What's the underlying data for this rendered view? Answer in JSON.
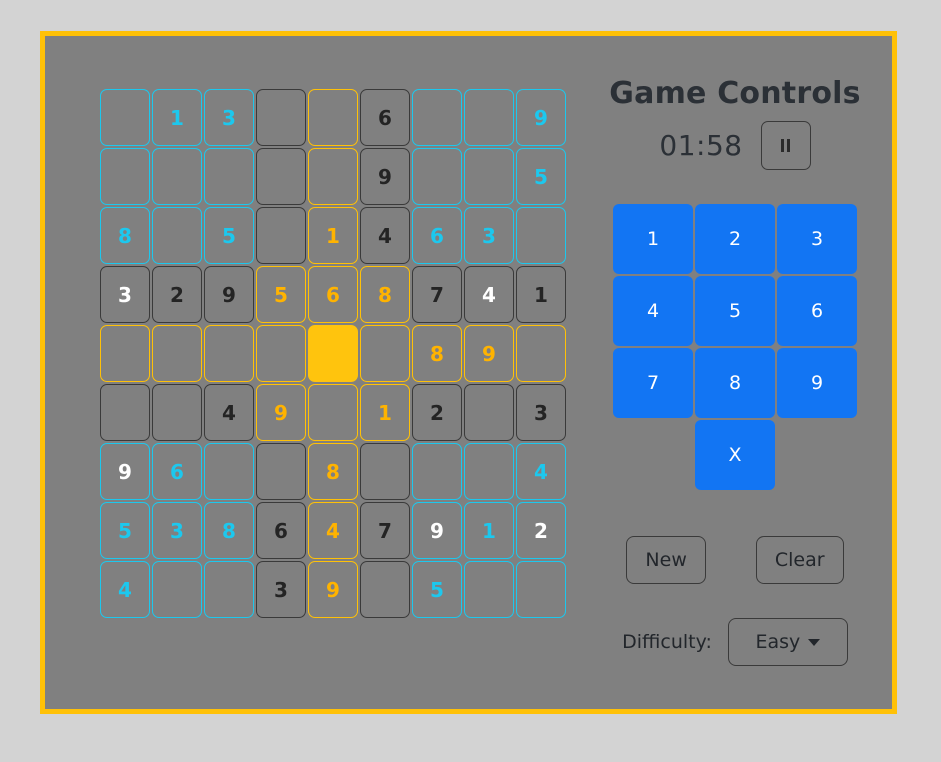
{
  "theme": {
    "page_background": "#d3d3d3",
    "panel_background": "#808080",
    "panel_border": "#ffc107",
    "accent_blue": "#1275f3",
    "highlight_cyan": "#1cc8ee",
    "highlight_gold": "#ffb300",
    "selected_cell_fill": "#ffc40d"
  },
  "panel": {
    "title": "Game Controls",
    "timer": "01:58",
    "pause_button_label": "II",
    "pause_icon": "pause-icon"
  },
  "numpad": {
    "keys": [
      "1",
      "2",
      "3",
      "4",
      "5",
      "6",
      "7",
      "8",
      "9"
    ],
    "erase_label": "X"
  },
  "actions": {
    "new_label": "New",
    "clear_label": "Clear"
  },
  "difficulty": {
    "label": "Difficulty:",
    "selected": "Easy",
    "caret_icon": "chevron-down-icon"
  },
  "board": {
    "rows": 9,
    "cols": 9,
    "selected": {
      "row": 4,
      "col": 4
    },
    "cells": [
      [
        {
          "value": "",
          "border": "cyan",
          "text": "cyan"
        },
        {
          "value": "1",
          "border": "cyan",
          "text": "cyan"
        },
        {
          "value": "3",
          "border": "cyan",
          "text": "cyan"
        },
        {
          "value": "",
          "border": "dark",
          "text": "dark"
        },
        {
          "value": "",
          "border": "gold",
          "text": "gold"
        },
        {
          "value": "6",
          "border": "dark",
          "text": "dark"
        },
        {
          "value": "",
          "border": "cyan",
          "text": "cyan"
        },
        {
          "value": "",
          "border": "cyan",
          "text": "cyan"
        },
        {
          "value": "9",
          "border": "cyan",
          "text": "cyan"
        }
      ],
      [
        {
          "value": "",
          "border": "cyan",
          "text": "cyan"
        },
        {
          "value": "",
          "border": "cyan",
          "text": "cyan"
        },
        {
          "value": "",
          "border": "cyan",
          "text": "cyan"
        },
        {
          "value": "",
          "border": "dark",
          "text": "dark"
        },
        {
          "value": "",
          "border": "gold",
          "text": "gold"
        },
        {
          "value": "9",
          "border": "dark",
          "text": "dark"
        },
        {
          "value": "",
          "border": "cyan",
          "text": "cyan"
        },
        {
          "value": "",
          "border": "cyan",
          "text": "cyan"
        },
        {
          "value": "5",
          "border": "cyan",
          "text": "cyan"
        }
      ],
      [
        {
          "value": "8",
          "border": "cyan",
          "text": "cyan"
        },
        {
          "value": "",
          "border": "cyan",
          "text": "cyan"
        },
        {
          "value": "5",
          "border": "cyan",
          "text": "cyan"
        },
        {
          "value": "",
          "border": "dark",
          "text": "dark"
        },
        {
          "value": "1",
          "border": "gold",
          "text": "gold"
        },
        {
          "value": "4",
          "border": "dark",
          "text": "dark"
        },
        {
          "value": "6",
          "border": "cyan",
          "text": "cyan"
        },
        {
          "value": "3",
          "border": "cyan",
          "text": "cyan"
        },
        {
          "value": "",
          "border": "cyan",
          "text": "cyan"
        }
      ],
      [
        {
          "value": "3",
          "border": "dark",
          "text": "white"
        },
        {
          "value": "2",
          "border": "dark",
          "text": "dark"
        },
        {
          "value": "9",
          "border": "dark",
          "text": "dark"
        },
        {
          "value": "5",
          "border": "gold",
          "text": "gold"
        },
        {
          "value": "6",
          "border": "gold",
          "text": "gold"
        },
        {
          "value": "8",
          "border": "gold",
          "text": "gold"
        },
        {
          "value": "7",
          "border": "dark",
          "text": "dark"
        },
        {
          "value": "4",
          "border": "dark",
          "text": "white"
        },
        {
          "value": "1",
          "border": "dark",
          "text": "dark"
        }
      ],
      [
        {
          "value": "",
          "border": "gold",
          "text": "gold"
        },
        {
          "value": "",
          "border": "gold",
          "text": "gold"
        },
        {
          "value": "",
          "border": "gold",
          "text": "gold"
        },
        {
          "value": "",
          "border": "gold",
          "text": "gold"
        },
        {
          "value": "",
          "border": "selected",
          "text": "dark"
        },
        {
          "value": "",
          "border": "gold",
          "text": "gold"
        },
        {
          "value": "8",
          "border": "gold",
          "text": "gold"
        },
        {
          "value": "9",
          "border": "gold",
          "text": "gold"
        },
        {
          "value": "",
          "border": "gold",
          "text": "gold"
        }
      ],
      [
        {
          "value": "",
          "border": "dark",
          "text": "dark"
        },
        {
          "value": "",
          "border": "dark",
          "text": "dark"
        },
        {
          "value": "4",
          "border": "dark",
          "text": "dark"
        },
        {
          "value": "9",
          "border": "gold",
          "text": "gold"
        },
        {
          "value": "",
          "border": "gold",
          "text": "gold"
        },
        {
          "value": "1",
          "border": "gold",
          "text": "gold"
        },
        {
          "value": "2",
          "border": "dark",
          "text": "dark"
        },
        {
          "value": "",
          "border": "dark",
          "text": "dark"
        },
        {
          "value": "3",
          "border": "dark",
          "text": "dark"
        }
      ],
      [
        {
          "value": "9",
          "border": "cyan",
          "text": "white"
        },
        {
          "value": "6",
          "border": "cyan",
          "text": "cyan"
        },
        {
          "value": "",
          "border": "cyan",
          "text": "cyan"
        },
        {
          "value": "",
          "border": "dark",
          "text": "dark"
        },
        {
          "value": "8",
          "border": "gold",
          "text": "gold"
        },
        {
          "value": "",
          "border": "dark",
          "text": "dark"
        },
        {
          "value": "",
          "border": "cyan",
          "text": "cyan"
        },
        {
          "value": "",
          "border": "cyan",
          "text": "cyan"
        },
        {
          "value": "4",
          "border": "cyan",
          "text": "cyan"
        }
      ],
      [
        {
          "value": "5",
          "border": "cyan",
          "text": "cyan"
        },
        {
          "value": "3",
          "border": "cyan",
          "text": "cyan"
        },
        {
          "value": "8",
          "border": "cyan",
          "text": "cyan"
        },
        {
          "value": "6",
          "border": "dark",
          "text": "dark"
        },
        {
          "value": "4",
          "border": "gold",
          "text": "gold"
        },
        {
          "value": "7",
          "border": "dark",
          "text": "dark"
        },
        {
          "value": "9",
          "border": "cyan",
          "text": "white"
        },
        {
          "value": "1",
          "border": "cyan",
          "text": "cyan"
        },
        {
          "value": "2",
          "border": "cyan",
          "text": "white"
        }
      ],
      [
        {
          "value": "4",
          "border": "cyan",
          "text": "cyan"
        },
        {
          "value": "",
          "border": "cyan",
          "text": "cyan"
        },
        {
          "value": "",
          "border": "cyan",
          "text": "cyan"
        },
        {
          "value": "3",
          "border": "dark",
          "text": "dark"
        },
        {
          "value": "9",
          "border": "gold",
          "text": "gold"
        },
        {
          "value": "",
          "border": "dark",
          "text": "dark"
        },
        {
          "value": "5",
          "border": "cyan",
          "text": "cyan"
        },
        {
          "value": "",
          "border": "cyan",
          "text": "cyan"
        },
        {
          "value": "",
          "border": "cyan",
          "text": "cyan"
        }
      ]
    ]
  }
}
